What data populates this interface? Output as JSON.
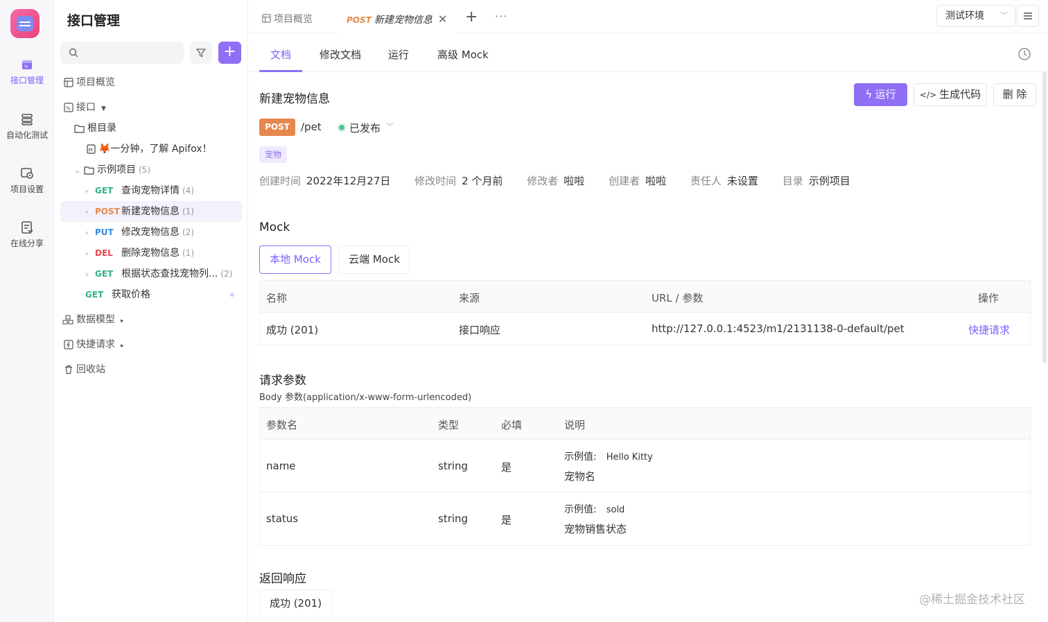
{
  "rail": {
    "items": [
      {
        "label": "接口管理",
        "icon": "api-icon",
        "active": true
      },
      {
        "label": "自动化测试",
        "icon": "test-icon"
      },
      {
        "label": "项目设置",
        "icon": "settings-icon"
      },
      {
        "label": "在线分享",
        "icon": "share-icon"
      }
    ]
  },
  "sidebar": {
    "title": "接口管理",
    "overview": "项目概览",
    "api_root": "接口",
    "root_dir": "根目录",
    "intro_doc": "🦊一分钟，了解 Apifox！",
    "folder": {
      "name": "示例项目",
      "count": "(5)"
    },
    "endpoints": [
      {
        "method": "GET",
        "name": "查询宠物详情",
        "count": "(4)"
      },
      {
        "method": "POST",
        "name": "新建宠物信息",
        "count": "(1)"
      },
      {
        "method": "PUT",
        "name": "修改宠物信息",
        "count": "(2)"
      },
      {
        "method": "DEL",
        "name": "删除宠物信息",
        "count": "(1)"
      },
      {
        "method": "GET",
        "name": "根据状态查找宠物列...",
        "count": "(2)"
      }
    ],
    "extra_get": {
      "method": "GET",
      "name": "获取价格"
    },
    "data_model": "数据模型",
    "quick_request": "快捷请求",
    "recycle": "回收站"
  },
  "topbar": {
    "tab_overview": "项目概览",
    "tab_active_method": "POST",
    "tab_active_name": "新建宠物信息",
    "more": "···",
    "env": "测试环境"
  },
  "subtabs": [
    "文档",
    "修改文档",
    "运行",
    "高级 Mock"
  ],
  "detail": {
    "title": "新建宠物信息",
    "run": "运行",
    "gen_code": "生成代码",
    "delete": "删 除",
    "method": "POST",
    "path": "/pet",
    "status": "已发布",
    "tag": "宠物",
    "meta": [
      {
        "k": "创建时间",
        "v": "2022年12月27日"
      },
      {
        "k": "修改时间",
        "v": "2 个月前"
      },
      {
        "k": "修改者",
        "v": "啦啦"
      },
      {
        "k": "创建者",
        "v": "啦啦"
      },
      {
        "k": "责任人",
        "v": "未设置"
      },
      {
        "k": "目录",
        "v": "示例项目"
      }
    ]
  },
  "mock": {
    "section": "Mock",
    "tab_local": "本地 Mock",
    "tab_cloud": "云端 Mock",
    "headers": [
      "名称",
      "来源",
      "URL / 参数",
      "操作"
    ],
    "row": {
      "name": "成功 (201)",
      "source": "接口响应",
      "url": "http://127.0.0.1:4523/m1/2131138-0-default/pet",
      "action": "快捷请求"
    }
  },
  "params": {
    "section": "请求参数",
    "body_note": "Body 参数(application/x-www-form-urlencoded)",
    "headers": [
      "参数名",
      "类型",
      "必填",
      "说明"
    ],
    "example_label": "示例值:",
    "rows": [
      {
        "name": "name",
        "type": "string",
        "required": "是",
        "example": "Hello Kitty",
        "desc": "宠物名"
      },
      {
        "name": "status",
        "type": "string",
        "required": "是",
        "example": "sold",
        "desc": "宠物销售状态"
      }
    ]
  },
  "response": {
    "section": "返回响应",
    "tab": "成功 (201)"
  },
  "watermark": "@稀土掘金技术社区",
  "colors": {
    "accent": "#8e6ff5",
    "post": "#e6884d",
    "get": "#34b07f",
    "put": "#2f8ae0",
    "del": "#e5484d"
  }
}
